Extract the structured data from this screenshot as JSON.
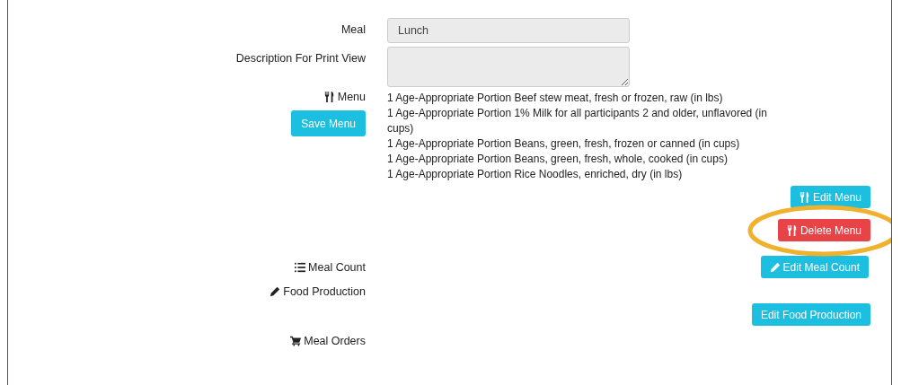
{
  "meal": {
    "label": "Meal",
    "value": "Lunch",
    "disabled": true
  },
  "description": {
    "label": "Description For Print View",
    "disabled": true
  },
  "menu": {
    "label": "Menu",
    "save_button": "Save Menu",
    "items": [
      "1 Age-Appropriate Portion Beef stew meat, fresh or frozen, raw (in lbs)",
      "1 Age-Appropriate Portion 1% Milk for all participants 2 and older, unflavored (in cups)",
      "1 Age-Appropriate Portion Beans, green, fresh, frozen or canned (in cups)",
      "1 Age-Appropriate Portion Beans, green, fresh, whole, cooked (in cups)",
      "1 Age-Appropriate Portion Rice Noodles, enriched, dry (in lbs)"
    ],
    "buttons": [
      {
        "label": "Edit Menu",
        "kind": "edit",
        "highlighted": false
      },
      {
        "label": "Delete Menu",
        "kind": "delete",
        "highlighted": true
      }
    ]
  },
  "meal_count": {
    "label": "Meal Count",
    "button": "Edit Meal Count"
  },
  "food_production": {
    "label": "Food Production",
    "button": "Edit Food Production"
  },
  "meal_orders": {
    "label": "Meal Orders"
  }
}
